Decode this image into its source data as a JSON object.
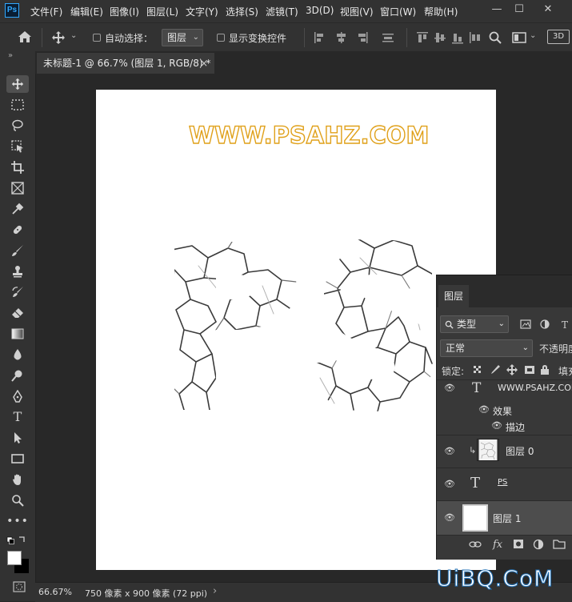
{
  "app": {
    "logo": "Ps"
  },
  "menu": [
    "文件(F)",
    "编辑(E)",
    "图像(I)",
    "图层(L)",
    "文字(Y)",
    "选择(S)",
    "滤镜(T)",
    "3D(D)",
    "视图(V)",
    "窗口(W)",
    "帮助(H)"
  ],
  "window_controls": {
    "minimize": "—",
    "restore": "☐",
    "close": "✕"
  },
  "options_bar": {
    "auto_select_label": "自动选择：",
    "auto_select_value": "图层",
    "show_transform_label": "显示变换控件",
    "three_d_label": "3D"
  },
  "document_tab": {
    "title": "未标题-1 @ 66.7% (图层 1, RGB/8) *",
    "close": "×"
  },
  "canvas": {
    "watermark_text": "WWW.PSAHZ.COM",
    "brand_color": "#e0a11b"
  },
  "status": {
    "zoom": "66.67%",
    "doc_info": "750 像素 x 900 像素 (72 ppi)",
    "arrow": "›"
  },
  "layers_panel": {
    "tab": "图层",
    "filter_kind": "类型",
    "blend_mode": "正常",
    "opacity_label": "不透明度",
    "lock_label": "锁定:",
    "fill_label": "填充",
    "layers": [
      {
        "name": "WWW.PSAHZ.COM",
        "type": "text"
      },
      {
        "name": "效果",
        "type": "effects"
      },
      {
        "name": "描边",
        "type": "effect"
      },
      {
        "name": "图层 0",
        "type": "texture"
      },
      {
        "name": "PS",
        "type": "text"
      },
      {
        "name": "图层 1",
        "type": "fill",
        "selected": true
      }
    ],
    "footer_icons": [
      "link-icon",
      "fx-icon",
      "mask-icon",
      "adjustment-icon",
      "folder-icon"
    ]
  },
  "site_watermark": "UiBQ.CoM"
}
